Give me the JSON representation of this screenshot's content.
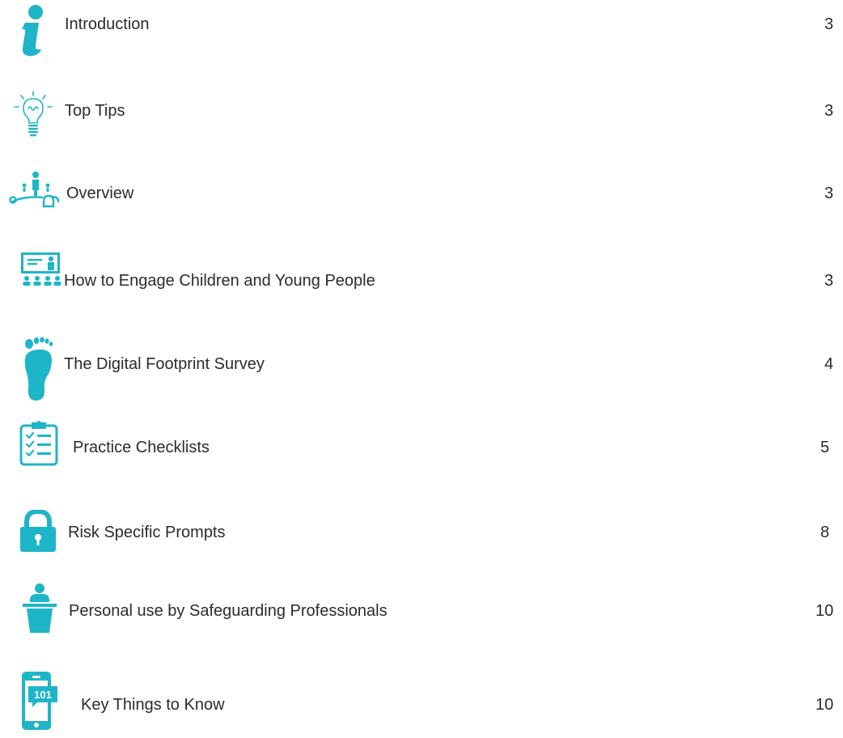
{
  "colors": {
    "accent": "#1fb5c8",
    "text": "#2b2b2b"
  },
  "toc": {
    "entries": [
      {
        "icon": "info-icon",
        "title": "Introduction",
        "page": "3"
      },
      {
        "icon": "lightbulb-icon",
        "title": "Top Tips",
        "page": "3"
      },
      {
        "icon": "person-map-pins-icon",
        "title": "Overview",
        "page": "3"
      },
      {
        "icon": "presentation-audience-icon",
        "title": "How to Engage Children and Young People",
        "page": "3"
      },
      {
        "icon": "footprint-icon",
        "title": "The Digital Footprint Survey",
        "page": "4"
      },
      {
        "icon": "clipboard-checklist-icon",
        "title": "Practice Checklists",
        "page": "5"
      },
      {
        "icon": "padlock-icon",
        "title": "Risk Specific Prompts",
        "page": "8"
      },
      {
        "icon": "speaker-podium-icon",
        "title": "Personal use by Safeguarding Professionals",
        "page": "10"
      },
      {
        "icon": "smartphone-101-icon",
        "title": "Key Things to Know",
        "page": "10"
      },
      {
        "icon_text": "101"
      }
    ]
  }
}
